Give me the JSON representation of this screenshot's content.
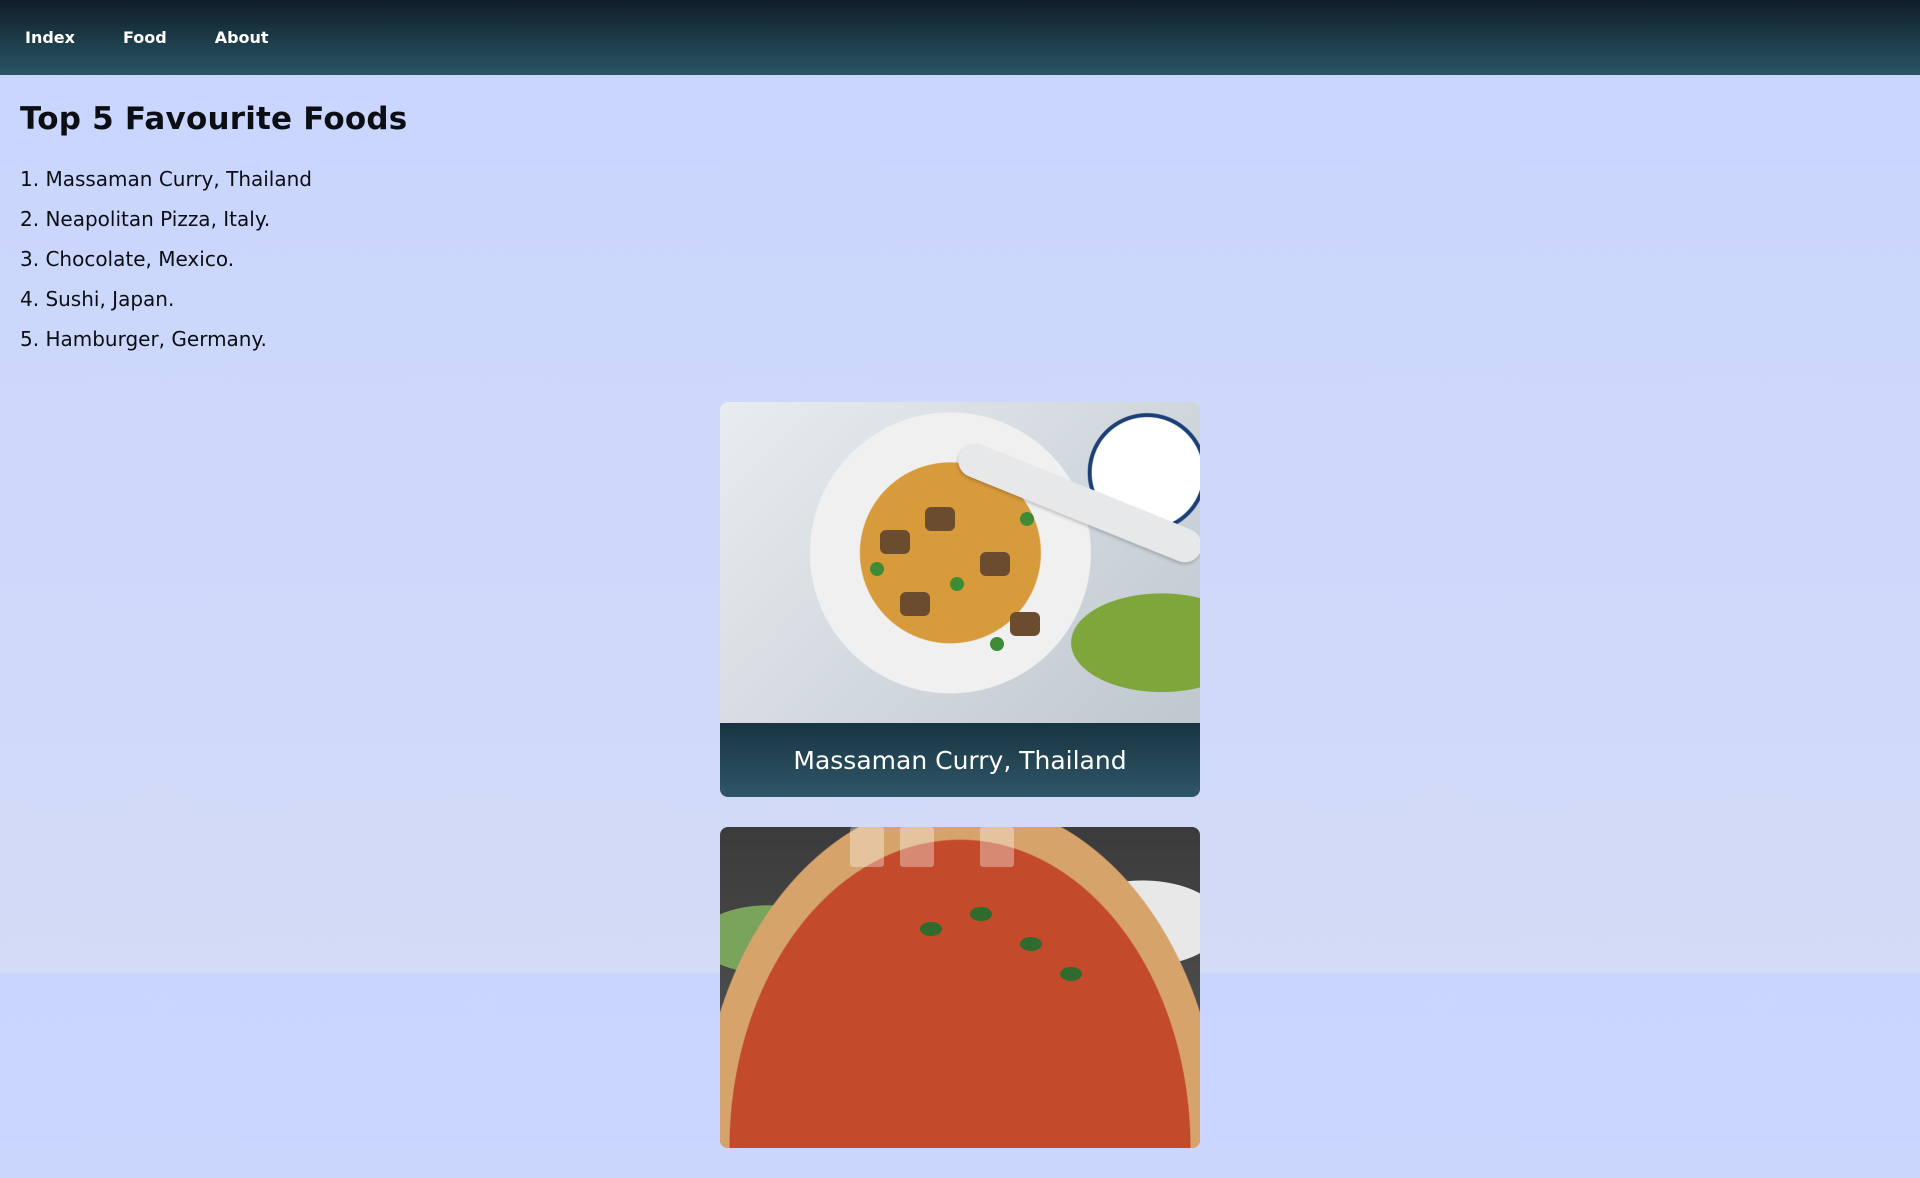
{
  "nav": {
    "items": [
      {
        "label": "Index"
      },
      {
        "label": "Food"
      },
      {
        "label": "About"
      }
    ]
  },
  "main": {
    "title": "Top 5 Favourite Foods",
    "list": [
      "1. Massaman Curry, Thailand",
      "2. Neapolitan Pizza, Italy.",
      "3. Chocolate, Mexico.",
      "4. Sushi, Japan.",
      "5. Hamburger, Germany."
    ],
    "cards": [
      {
        "caption": "Massaman Curry, Thailand",
        "image": "massaman-curry-photo"
      },
      {
        "caption": "",
        "image": "neapolitan-pizza-photo"
      }
    ]
  },
  "colors": {
    "navbar": "#1b3a47",
    "background": "#cad6ff",
    "caption_bg": "#1e3f4e"
  }
}
